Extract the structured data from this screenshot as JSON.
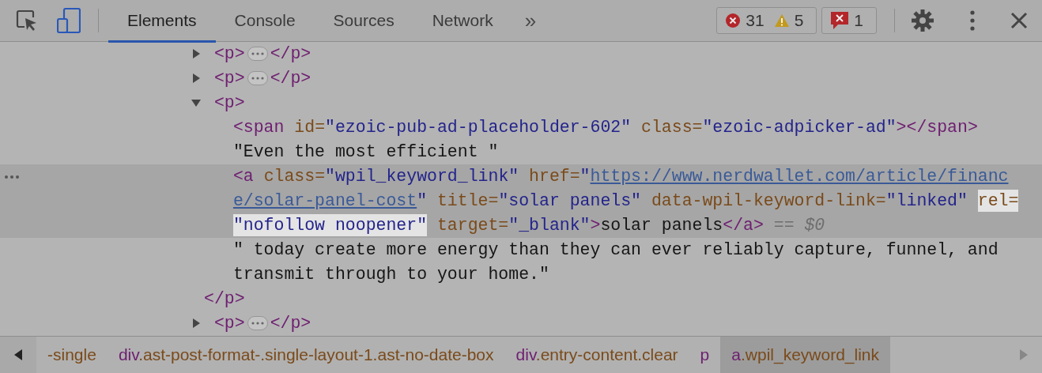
{
  "toolbar": {
    "tabs": [
      {
        "label": "Elements",
        "selected": true
      },
      {
        "label": "Console",
        "selected": false
      },
      {
        "label": "Sources",
        "selected": false
      },
      {
        "label": "Network",
        "selected": false
      }
    ],
    "overflow": "»",
    "errors": "31",
    "warnings": "5",
    "issues": "1"
  },
  "tree": [
    {
      "expanded": false,
      "selected": false,
      "lines": [
        [
          [
            {
              "kind": "tag",
              "text": "<p>"
            },
            {
              "kind": "ellipsis"
            },
            {
              "kind": "tag",
              "text": "</p>"
            }
          ]
        ]
      ]
    },
    {
      "expanded": false,
      "selected": false,
      "lines": [
        [
          [
            {
              "kind": "tag",
              "text": "<p>"
            },
            {
              "kind": "ellipsis"
            },
            {
              "kind": "tag",
              "text": "</p>"
            }
          ]
        ]
      ]
    },
    {
      "expanded": true,
      "selected": false,
      "lines": [
        [
          [
            {
              "kind": "tag",
              "text": "<p>"
            }
          ]
        ]
      ],
      "children": [
        {
          "selected": false,
          "lines": [
            [
              [
                {
                  "kind": "tag",
                  "text": "<span"
                }
              ],
              [
                {
                  "kind": "attr",
                  "text": "id="
                },
                {
                  "kind": "value",
                  "text": "\"ezoic-pub-ad-placeholder-602\""
                }
              ],
              [
                {
                  "kind": "attr",
                  "text": "class="
                },
                {
                  "kind": "value",
                  "text": "\"ezoic-adpicker-ad\""
                },
                {
                  "kind": "tag",
                  "text": "></span>"
                }
              ]
            ]
          ]
        },
        {
          "selected": false,
          "lines": [
            [
              [
                {
                  "kind": "text",
                  "text": "\"Even the most efficient \""
                }
              ]
            ]
          ]
        },
        {
          "selected": true,
          "lines": [
            [
              [
                {
                  "kind": "tag",
                  "text": "<a"
                }
              ],
              [
                {
                  "kind": "attr",
                  "text": "class="
                },
                {
                  "kind": "value",
                  "text": "\"wpil_keyword_link\""
                }
              ],
              [
                {
                  "kind": "attr",
                  "text": "href="
                },
                {
                  "kind": "value",
                  "text": "\""
                },
                {
                  "kind": "link",
                  "text": "https://www.nerdwallet.com/article/financ"
                }
              ]
            ],
            [
              [
                {
                  "kind": "link",
                  "text": "e/solar-panel-cost",
                  "highlighted": false
                },
                {
                  "kind": "value",
                  "text": "\"",
                  "highlighted": false
                }
              ],
              [
                {
                  "kind": "attr",
                  "text": "title=",
                  "highlighted": false
                },
                {
                  "kind": "value",
                  "text": "\"solar panels\"",
                  "highlighted": false
                }
              ],
              [
                {
                  "kind": "attr",
                  "text": "data-wpil-keyword-link=",
                  "highlighted": false
                },
                {
                  "kind": "value",
                  "text": "\"linked\"",
                  "highlighted": false
                }
              ],
              [
                {
                  "kind": "attr",
                  "text": "rel=",
                  "highlighted": true
                }
              ]
            ],
            [
              [
                {
                  "kind": "value",
                  "text": "\"nofollow noopener\"",
                  "highlighted": true
                }
              ],
              [
                {
                  "kind": "attr",
                  "text": "target=",
                  "highlighted": false
                },
                {
                  "kind": "value",
                  "text": "\"_blank\"",
                  "highlighted": false
                },
                {
                  "kind": "tag",
                  "text": ">",
                  "highlighted": false
                },
                {
                  "kind": "text",
                  "text": "solar panels",
                  "highlighted": false
                },
                {
                  "kind": "tag",
                  "text": "</a>",
                  "highlighted": false
                }
              ],
              [
                {
                  "kind": "hint",
                  "text": "==",
                  "highlighted": false
                }
              ],
              [
                {
                  "kind": "var",
                  "text": "$0",
                  "highlighted": false
                }
              ]
            ]
          ]
        },
        {
          "selected": false,
          "lines": [
            [
              [
                {
                  "kind": "text",
                  "text": "\" today create more energy than they can ever reliably capture, funnel, and"
                }
              ]
            ],
            [
              [
                {
                  "kind": "text",
                  "text": "transmit through to your home.\""
                }
              ]
            ]
          ]
        }
      ],
      "close": [
        [
          {
            "kind": "tag",
            "text": "</p>"
          }
        ]
      ]
    },
    {
      "expanded": false,
      "selected": false,
      "lines": [
        [
          [
            {
              "kind": "tag",
              "text": "<p>"
            },
            {
              "kind": "ellipsis"
            },
            {
              "kind": "tag",
              "text": "</p>"
            }
          ]
        ]
      ]
    }
  ],
  "breadcrumbs": [
    {
      "rest": "-single",
      "selected": false
    },
    {
      "tag": "div",
      "rest": ".ast-post-format-.single-layout-1.ast-no-date-box",
      "selected": false
    },
    {
      "tag": "div",
      "rest": ".entry-content.clear",
      "selected": false
    },
    {
      "tag": "p",
      "selected": false
    },
    {
      "tag": "a",
      "rest": ".wpil_keyword_link",
      "selected": true
    }
  ]
}
